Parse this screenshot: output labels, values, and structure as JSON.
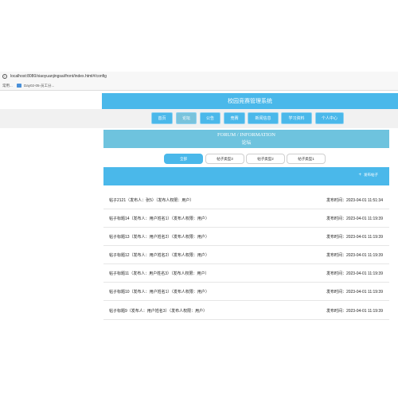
{
  "browser": {
    "url": "localhost:8080/xiaoyuanjingsai/front/index.html#/config",
    "bookmarks": [
      "常用...",
      "Day02-05-员工分..."
    ]
  },
  "site": {
    "title": "校园竞赛管理系统",
    "nav": [
      "首页",
      "论坛",
      "公告",
      "竞赛",
      "新闻信息",
      "学习资料",
      "个人中心"
    ],
    "active_nav": "论坛"
  },
  "forum": {
    "banner_en": "FORUM / INFORMATION",
    "banner_cn": "论坛",
    "categories": [
      "全部",
      "帖子类型3",
      "帖子类型2",
      "帖子类型1"
    ],
    "active_category": "全部",
    "post_button": "发布帖子",
    "posts": [
      {
        "title": "帖子2121（发布人：张5）（发布人权限：用户）",
        "time": "发布时间：2023-04-01 11:51:34"
      },
      {
        "title": "帖子标题14（发布人：用户姓名1）（发布人权限：用户）",
        "time": "发布时间：2023-04-01 11:19:39"
      },
      {
        "title": "帖子标题13（发布人：用户姓名2）（发布人权限：用户）",
        "time": "发布时间：2023-04-01 11:19:39"
      },
      {
        "title": "帖子标题12（发布人：用户姓名2）（发布人权限：用户）",
        "time": "发布时间：2023-04-01 11:19:39"
      },
      {
        "title": "帖子标题11（发布人：用户姓名3）（发布人权限：用户）",
        "time": "发布时间：2023-04-01 11:19:39"
      },
      {
        "title": "帖子标题10（发布人：用户姓名1）（发布人权限：用户）",
        "time": "发布时间：2023-04-01 11:19:39"
      },
      {
        "title": "帖子标题9（发布人：用户姓名3）（发布人权限：用户）",
        "time": "发布时间：2023-04-01 11:19:39"
      }
    ]
  },
  "colors": {
    "primary": "#4ab8ea",
    "banner": "#6ec3de",
    "nav_bg": "#f1f1f1"
  }
}
